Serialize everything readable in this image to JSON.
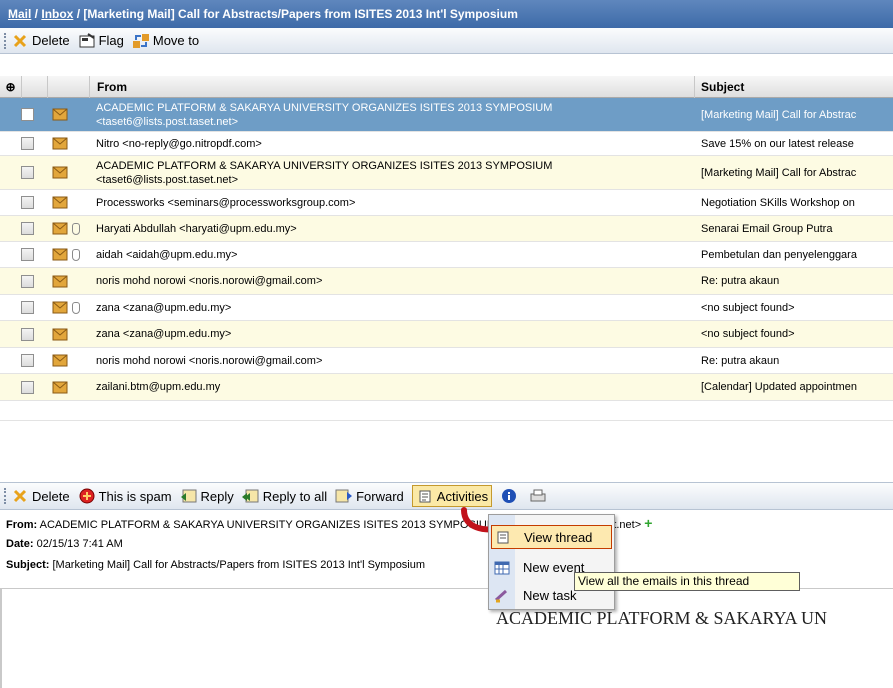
{
  "breadcrumb": {
    "mail": "Mail",
    "sep1": " / ",
    "inbox": "Inbox",
    "sep2": " / ",
    "subject": "[Marketing Mail] Call for Abstracts/Papers from ISITES 2013 Int'l Symposium"
  },
  "top_toolbar": {
    "delete": "Delete",
    "flag": "Flag",
    "move_to": "Move to"
  },
  "list_header": {
    "select_all_icon": "⊕",
    "from": "From",
    "subject": "Subject"
  },
  "messages": [
    {
      "from1": "ACADEMIC PLATFORM & SAKARYA UNIVERSITY ORGANIZES ISITES 2013 SYMPOSIUM",
      "from2": "<taset6@lists.post.taset.net>",
      "subject": "[Marketing Mail] Call for Abstrac",
      "attach": false,
      "selected": true
    },
    {
      "from1": "Nitro <no-reply@go.nitropdf.com>",
      "from2": "",
      "subject": "Save 15% on our latest release",
      "attach": false
    },
    {
      "from1": "ACADEMIC PLATFORM & SAKARYA UNIVERSITY ORGANIZES ISITES 2013 SYMPOSIUM",
      "from2": "<taset6@lists.post.taset.net>",
      "subject": "[Marketing Mail] Call for Abstrac",
      "attach": false
    },
    {
      "from1": "Processworks <seminars@processworksgroup.com>",
      "from2": "",
      "subject": "Negotiation SKills Workshop on",
      "attach": false
    },
    {
      "from1": "Haryati Abdullah <haryati@upm.edu.my>",
      "from2": "",
      "subject": "Senarai Email Group Putra",
      "attach": true
    },
    {
      "from1": "aidah <aidah@upm.edu.my>",
      "from2": "",
      "subject": "Pembetulan dan penyelenggara",
      "attach": true
    },
    {
      "from1": "noris mohd norowi <noris.norowi@gmail.com>",
      "from2": "",
      "subject": "Re: putra akaun",
      "attach": false
    },
    {
      "from1": "zana <zana@upm.edu.my>",
      "from2": "",
      "subject": "<no subject found>",
      "attach": true
    },
    {
      "from1": "zana <zana@upm.edu.my>",
      "from2": "",
      "subject": "<no subject found>",
      "attach": false
    },
    {
      "from1": "noris mohd norowi <noris.norowi@gmail.com>",
      "from2": "",
      "subject": "Re: putra akaun",
      "attach": false
    },
    {
      "from1": "zailani.btm@upm.edu.my",
      "from2": "",
      "subject": "[Calendar] Updated appointmen",
      "attach": false
    }
  ],
  "bottom_toolbar": {
    "delete": "Delete",
    "spam": "This is spam",
    "reply": "Reply",
    "reply_all": "Reply to all",
    "forward": "Forward",
    "activities": "Activities"
  },
  "preview": {
    "from_label": "From:",
    "from_value": "ACADEMIC PLATFORM & SAKARYA UNIVERSITY ORGANIZES ISITES 2013 SYMPOSIUM <taset6@lists.post.taset.net>",
    "date_label": "Date:",
    "date_value": "02/15/13 7:41 AM",
    "subject_label": "Subject:",
    "subject_value": "[Marketing Mail] Call for Abstracts/Papers from ISITES 2013 Int'l Symposium",
    "body_heading": "ACADEMIC PLATFORM & SAKARYA UN"
  },
  "activities_menu": {
    "view_thread": "View thread",
    "new_event": "New event",
    "new_task": "New task"
  },
  "tooltip": "View all the emails in this thread",
  "colors": {
    "title_bar": "#4f7ab5",
    "selected_row": "#6e9dc6",
    "odd_row": "#fdfbe3",
    "menu_highlight": "#fde9b0"
  }
}
